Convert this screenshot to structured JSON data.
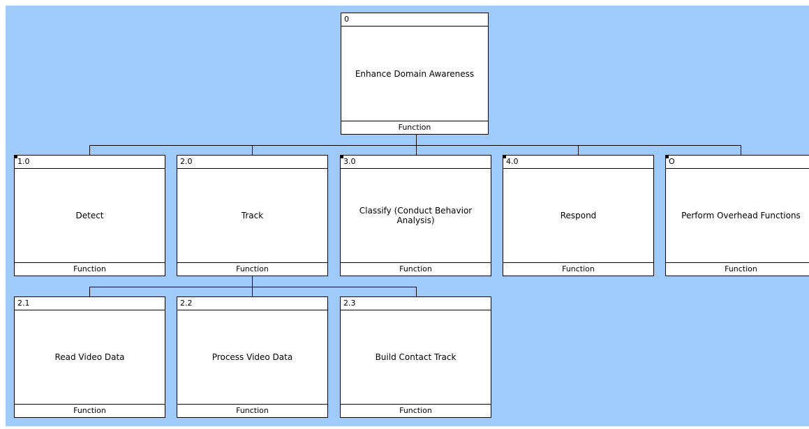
{
  "colors": {
    "background": "#9fcbfc",
    "node_fill": "#ffffff",
    "line": "#000000"
  },
  "nodes": {
    "root": {
      "id": "0",
      "label": "Enhance Domain Awareness",
      "type": "Function"
    },
    "detect": {
      "id": "1.0",
      "label": "Detect",
      "type": "Function"
    },
    "track": {
      "id": "2.0",
      "label": "Track",
      "type": "Function"
    },
    "classify": {
      "id": "3.0",
      "label": "Classify (Conduct Behavior Analysis)",
      "type": "Function"
    },
    "respond": {
      "id": "4.0",
      "label": "Respond",
      "type": "Function"
    },
    "overhead": {
      "id": "O",
      "label": "Perform Overhead Functions",
      "type": "Function"
    },
    "read": {
      "id": "2.1",
      "label": "Read Video Data",
      "type": "Function"
    },
    "process": {
      "id": "2.2",
      "label": "Process Video Data",
      "type": "Function"
    },
    "build": {
      "id": "2.3",
      "label": "Build Contact Track",
      "type": "Function"
    }
  }
}
